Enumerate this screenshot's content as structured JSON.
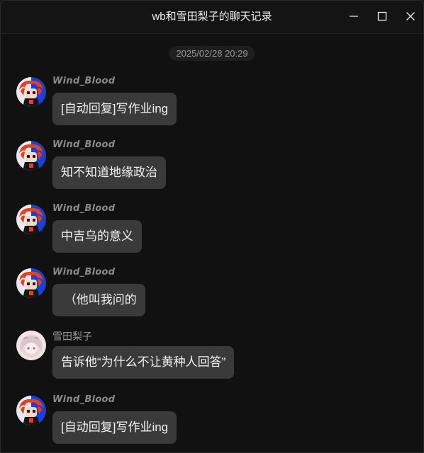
{
  "window": {
    "title": "wb和雪田梨子的聊天记录",
    "controls": {
      "minimize_icon": "minimize-icon",
      "maximize_icon": "maximize-icon",
      "close_icon": "close-icon"
    }
  },
  "chat": {
    "timestamp": "2025/02/28 20:29",
    "messages": [
      {
        "sender": "Wind_Blood",
        "text": "[自动回复]写作业ing",
        "avatar": "wind-blood-avatar"
      },
      {
        "sender": "Wind_Blood",
        "text": "知不知道地缘政治",
        "avatar": "wind-blood-avatar"
      },
      {
        "sender": "Wind_Blood",
        "text": "中吉乌的意义",
        "avatar": "wind-blood-avatar"
      },
      {
        "sender": "Wind_Blood",
        "text": " （他叫我问的",
        "avatar": "wind-blood-avatar"
      },
      {
        "sender": "雪田梨子",
        "text": "告诉他“为什么不让黄种人回答”",
        "avatar": "yukiko-avatar"
      },
      {
        "sender": "Wind_Blood",
        "text": "[自动回复]写作业ing",
        "avatar": "wind-blood-avatar"
      }
    ]
  },
  "colors": {
    "background": "#111111",
    "bubble": "#3a3a3a",
    "sender_name": "#8a8a8a",
    "text": "#f2f2f2"
  }
}
